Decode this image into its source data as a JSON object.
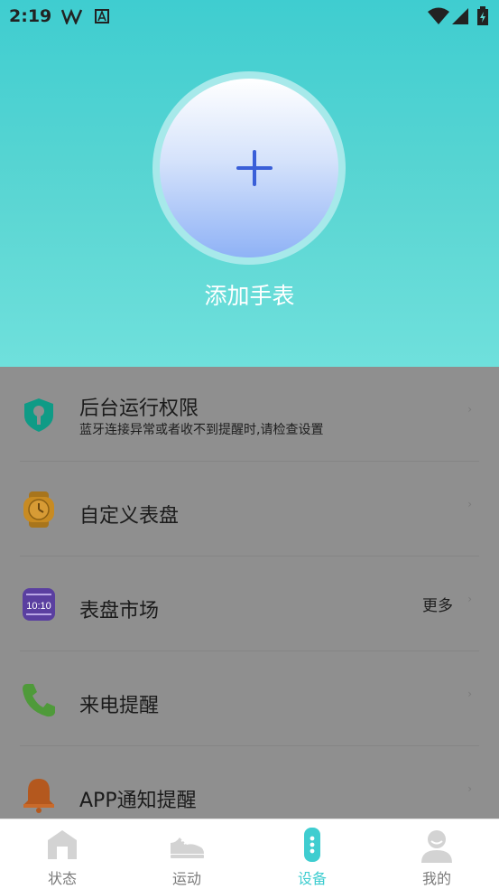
{
  "status_bar": {
    "time": "2:19"
  },
  "header": {
    "add_label": "添加手表"
  },
  "list": {
    "items": [
      {
        "title": "后台运行权限",
        "subtitle": "蓝牙连接异常或者收不到提醒时,请检查设置",
        "icon": "shield-key-icon"
      },
      {
        "title": "自定义表盘",
        "icon": "watch-icon"
      },
      {
        "title": "表盘市场",
        "more": "更多",
        "icon": "watch-face-market-icon",
        "icon_text": "10:10"
      },
      {
        "title": "来电提醒",
        "icon": "phone-icon"
      },
      {
        "title": "APP通知提醒",
        "icon": "bell-icon"
      }
    ]
  },
  "tabbar": {
    "tabs": [
      {
        "label": "状态",
        "icon": "home-icon"
      },
      {
        "label": "运动",
        "icon": "shoe-icon"
      },
      {
        "label": "设备",
        "icon": "band-icon",
        "active": true
      },
      {
        "label": "我的",
        "icon": "user-icon"
      }
    ],
    "active_color": "#3fcdd0"
  }
}
